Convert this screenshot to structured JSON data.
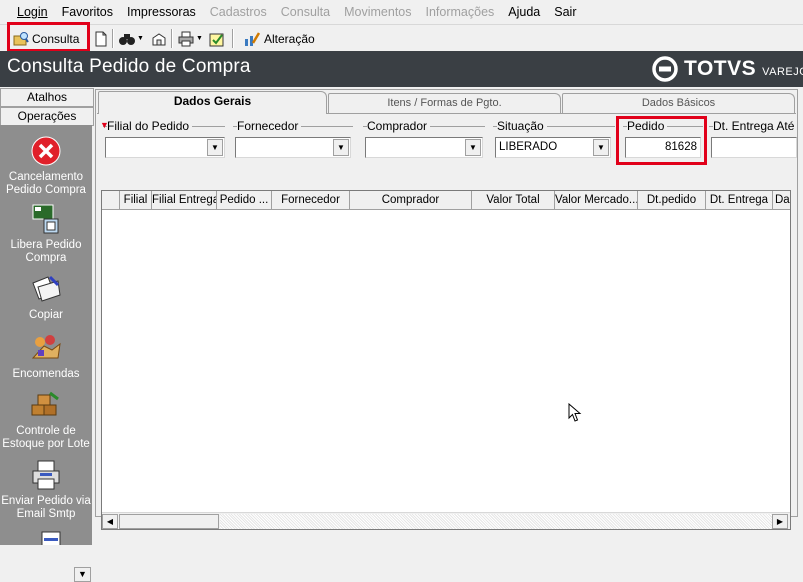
{
  "menu": [
    {
      "label": "Login",
      "enabled": true
    },
    {
      "label": "Favoritos",
      "enabled": true
    },
    {
      "label": "Impressoras",
      "enabled": true
    },
    {
      "label": "Cadastros",
      "enabled": false
    },
    {
      "label": "Consulta",
      "enabled": false
    },
    {
      "label": "Movimentos",
      "enabled": false
    },
    {
      "label": "Informações",
      "enabled": false
    },
    {
      "label": "Ajuda",
      "enabled": true
    },
    {
      "label": "Sair",
      "enabled": true
    }
  ],
  "toolbar": {
    "consulta_label": "Consulta",
    "alteracao_label": "Alteração"
  },
  "window": {
    "title": "Consulta Pedido de Compra",
    "logo_brand": "TOTVS",
    "logo_sub": "VAREJO"
  },
  "sidebar": {
    "tab_atalhos": "Atalhos",
    "tab_operacoes": "Operações",
    "items": [
      {
        "label": "Cancelamento Pedido Compra",
        "icon": "red-x-icon"
      },
      {
        "label": "Libera Pedido Compra",
        "icon": "release-order-icon"
      },
      {
        "label": "Copiar",
        "icon": "copy-icon"
      },
      {
        "label": "Encomendas",
        "icon": "orders-icon"
      },
      {
        "label": "Controle de Estoque por Lote",
        "icon": "boxes-icon"
      },
      {
        "label": "Enviar Pedido via Email Smtp",
        "icon": "printer-email-icon"
      }
    ]
  },
  "tabs": [
    {
      "label": "Dados Gerais",
      "active": true
    },
    {
      "label": "Itens / Formas de Pgto.",
      "active": false
    },
    {
      "label": "Dados Básicos",
      "active": false
    }
  ],
  "filters": {
    "filial_label": "Filial do Pedido",
    "filial_value": "",
    "fornecedor_label": "Fornecedor",
    "fornecedor_value": "",
    "comprador_label": "Comprador",
    "comprador_value": "",
    "situacao_label": "Situação",
    "situacao_value": "LIBERADO",
    "pedido_label": "Pedido",
    "pedido_value": "81628",
    "dt_entrega_label": "Dt. Entrega Até",
    "dt_entrega_value": ""
  },
  "grid": {
    "columns": [
      "",
      "Filial",
      "Filial Entrega",
      "Pedido ...",
      "Fornecedor",
      "Comprador",
      "Valor Total",
      "Valor Mercado...",
      "Dt.pedido",
      "Dt. Entrega",
      "Da"
    ]
  },
  "colors": {
    "titlebar_bg": "#3a3f44",
    "highlight": "#e1001a",
    "sidebar_bg": "#8e8e8e"
  }
}
